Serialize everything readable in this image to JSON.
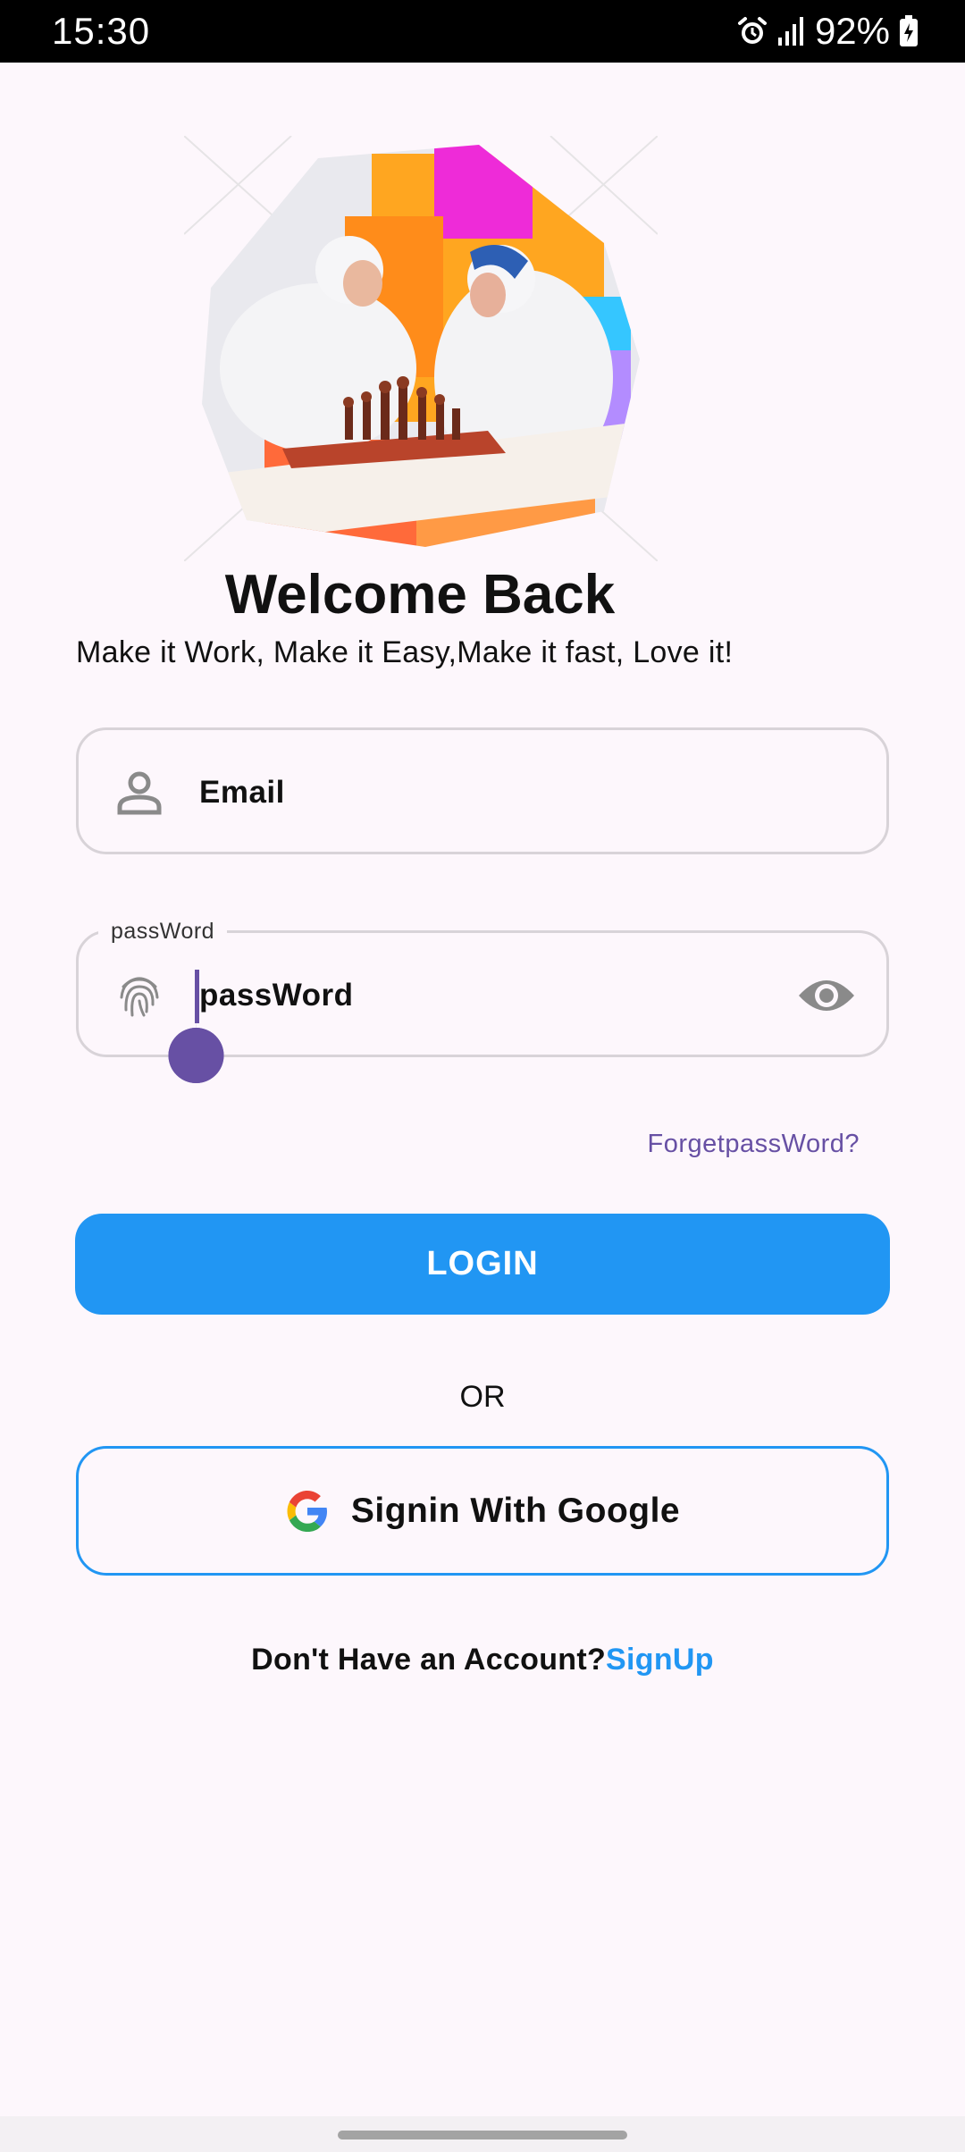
{
  "status_bar": {
    "time": "15:30",
    "battery": "92%",
    "icons": [
      "alarm-icon",
      "signal-icon",
      "battery-charging-icon"
    ]
  },
  "hero": {
    "image": "chess-players-illustration"
  },
  "header": {
    "title": "Welcome Back",
    "subtitle": "Make it Work, Make it Easy,Make it fast, Love it!"
  },
  "email_field": {
    "icon": "person-icon",
    "label": "Email"
  },
  "password_field": {
    "icon": "fingerprint-icon",
    "legend": "passWord",
    "value": "passWord",
    "toggle_icon": "eye-icon"
  },
  "forgot_password": "ForgetpassWord?",
  "login_button": "LOGIN",
  "divider_text": "OR",
  "google_button": {
    "icon": "google-icon",
    "label": "Signin With Google"
  },
  "signup": {
    "prompt": "Don't Have an Account?",
    "link": "SignUp"
  },
  "colors": {
    "primary": "#2196f3",
    "accent": "#6750a4",
    "background": "#fdf7fc"
  }
}
